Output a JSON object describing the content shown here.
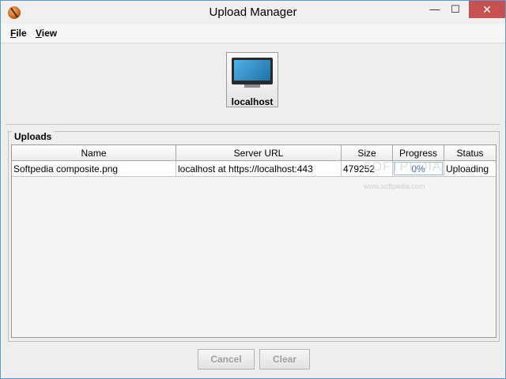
{
  "window": {
    "title": "Upload Manager",
    "minimize": "—",
    "maximize": "☐",
    "close": "✕"
  },
  "menu": {
    "file": {
      "accel": "F",
      "rest": "ile"
    },
    "view": {
      "accel": "V",
      "rest": "iew"
    }
  },
  "host": {
    "label": "localhost",
    "icon": "monitor-icon"
  },
  "uploads": {
    "section_title": "Uploads",
    "columns": [
      "Name",
      "Server URL",
      "Size",
      "Progress",
      "Status"
    ],
    "rows": [
      {
        "name": "Softpedia composite.png",
        "server_url": "localhost at https://localhost:443",
        "size": "479252",
        "progress_text": "0%",
        "progress": 0,
        "status": "Uploading"
      }
    ]
  },
  "buttons": {
    "cancel": "Cancel",
    "clear": "Clear"
  },
  "watermark": {
    "main": "SOFTPEDIA",
    "sub": "www.softpedia.com"
  },
  "colors": {
    "title_close_bg": "#c75050",
    "progress_text": "#3b5fb0"
  }
}
